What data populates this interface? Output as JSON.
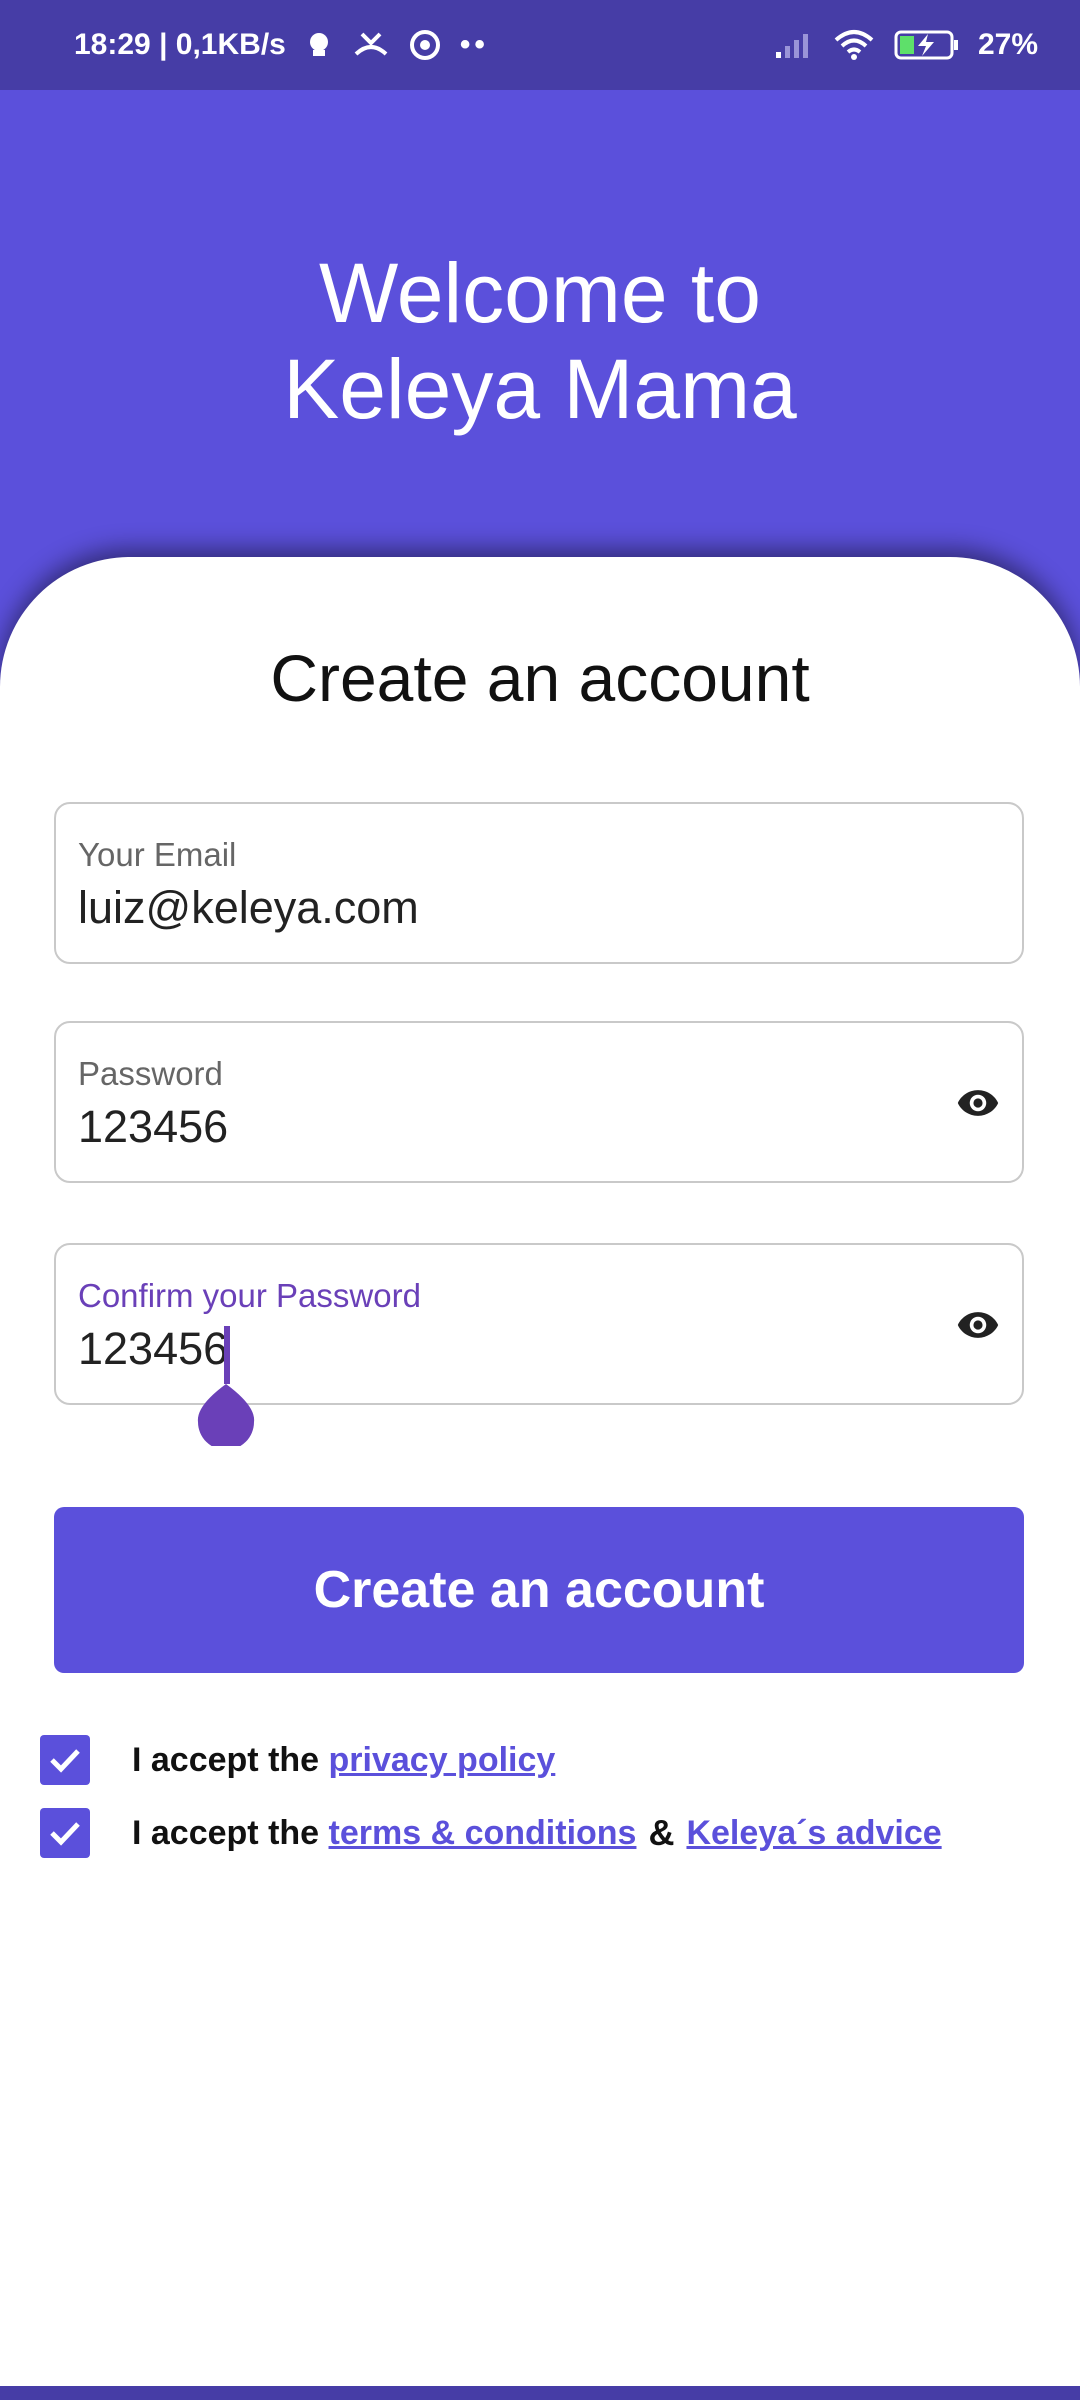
{
  "status_bar": {
    "time_speed": "18:29 | 0,1KB/s",
    "dots": "••",
    "battery": "27%"
  },
  "header": {
    "welcome_line1": "Welcome to",
    "welcome_line2": "Keleya Mama"
  },
  "form": {
    "title": "Create an account",
    "email": {
      "label": "Your Email",
      "value": "luiz@keleya.com"
    },
    "password": {
      "label": "Password",
      "value": "123456"
    },
    "confirm": {
      "label": "Confirm your Password",
      "value": "123456"
    },
    "submit_label": "Create an account"
  },
  "agreements": {
    "prefix": "I accept the",
    "privacy_link": "privacy policy",
    "terms_link": "terms & conditions",
    "amp": "&",
    "advice_link": "Keleya´s advice",
    "privacy_checked": true,
    "terms_checked": true
  },
  "colors": {
    "primary": "#5B50DB",
    "status_bar": "#463DA6",
    "focus": "#6A40B8"
  }
}
